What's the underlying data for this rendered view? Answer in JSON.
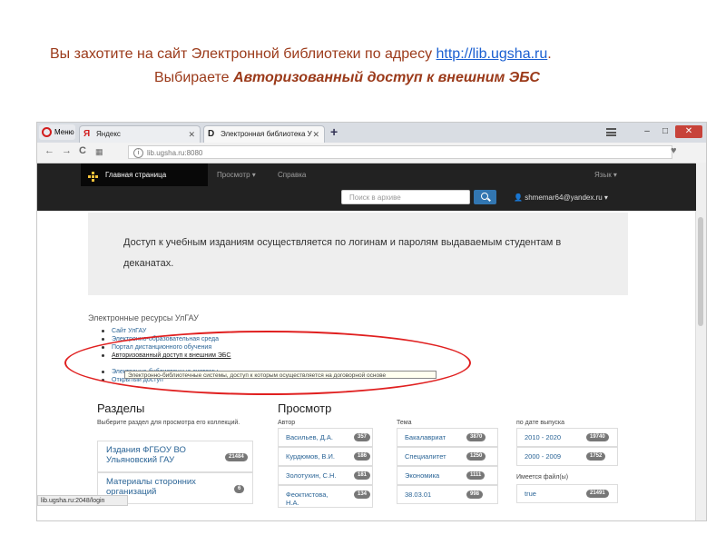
{
  "caption": {
    "line1_before": "Вы захотите на сайт Электронной библиотеки по адресу ",
    "line1_link": "http://lib.ugsha.ru",
    "line1_after": ".",
    "line2_before": "Выбираете ",
    "line2_bold": "Авторизованный доступ к внешним ЭБС"
  },
  "browser": {
    "menu_label": "Меню",
    "tab1_title": "Яндекс",
    "tab2_title": "Электронная библиотека У",
    "url": "lib.ugsha.ru:8080",
    "status_url": "lib.ugsha.ru:2048/login"
  },
  "site": {
    "nav_home": "Главная страница",
    "nav_browse": "Просмотр",
    "nav_help": "Справка",
    "nav_lang": "Язык",
    "search_placeholder": "Поиск в архиве",
    "user_email": "shmemar64@yandex.ru",
    "jumbotron_text": "Доступ к учебным изданиям осуществляется по логинам и паролям выдаваемым студентам в деканатах.",
    "resources_title": "Электронные ресурсы УлГАУ",
    "resources": [
      "Сайт УлГАУ",
      "Электронно-образовательная среда",
      "Портал дистанционного обучения",
      "Авторизованный доступ к внешним ЭБС",
      "Электронно-библиотечные системы",
      "Открытый доступ"
    ],
    "tooltip": "Электронно-библиотечные системы, доступ к которым осуществляется на договорной основе",
    "sections_title": "Разделы",
    "sections_hint": "Выберите раздел для просмотра его коллекций.",
    "sections": [
      {
        "name": "Издания ФГБОУ ВО Ульяновский ГАУ",
        "count": "21484"
      },
      {
        "name": "Материалы сторонних организаций",
        "count": "6"
      }
    ],
    "browse_title": "Просмотр",
    "author_header": "Автор",
    "authors": [
      {
        "name": "Васильев, Д.А.",
        "count": "357"
      },
      {
        "name": "Курдюмов, В.И.",
        "count": "186"
      },
      {
        "name": "Золотухин, С.Н.",
        "count": "181"
      },
      {
        "name": "Феоктистова, Н.А.",
        "count": "134"
      }
    ],
    "topic_header": "Тема",
    "topics": [
      {
        "name": "Бакалавриат",
        "count": "3870"
      },
      {
        "name": "Специалитет",
        "count": "1250"
      },
      {
        "name": "Экономика",
        "count": "1111"
      },
      {
        "name": "38.03.01",
        "count": "998"
      }
    ],
    "date_header": "по дате выпуска",
    "dates": [
      {
        "name": "2010 - 2020",
        "count": "19740"
      },
      {
        "name": "2000 - 2009",
        "count": "1752"
      }
    ],
    "files_header": "Имеется файл(ы)",
    "files": [
      {
        "name": "true",
        "count": "21491"
      }
    ]
  }
}
